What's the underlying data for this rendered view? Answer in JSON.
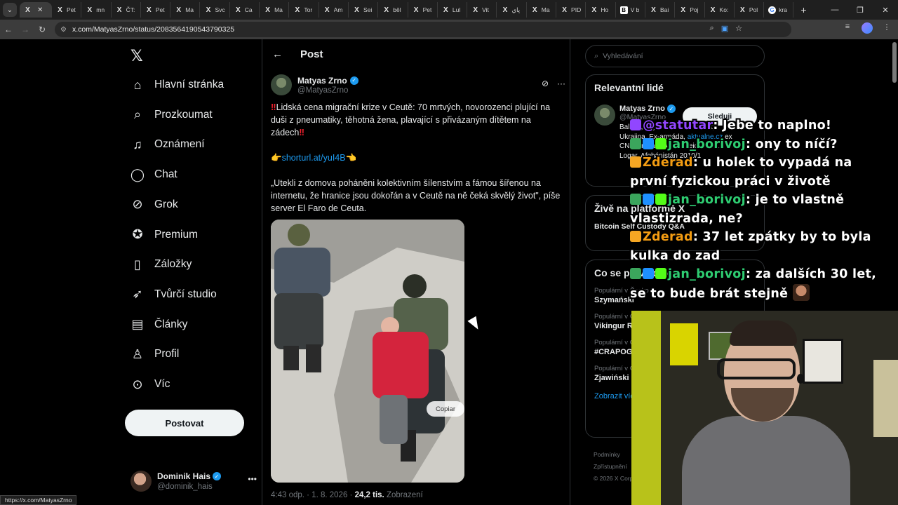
{
  "browser": {
    "tabs": [
      {
        "icon": "X",
        "title": "",
        "active": true
      },
      {
        "icon": "X",
        "title": "Pet"
      },
      {
        "icon": "X",
        "title": "mn"
      },
      {
        "icon": "X",
        "title": "ČT:"
      },
      {
        "icon": "X",
        "title": "Pet"
      },
      {
        "icon": "X",
        "title": "Ma"
      },
      {
        "icon": "X",
        "title": "Svc"
      },
      {
        "icon": "X",
        "title": "Ca"
      },
      {
        "icon": "X",
        "title": "Ma"
      },
      {
        "icon": "X",
        "title": "Tor"
      },
      {
        "icon": "X",
        "title": "Am"
      },
      {
        "icon": "X",
        "title": "Sei"
      },
      {
        "icon": "X",
        "title": "běl"
      },
      {
        "icon": "X",
        "title": "Pet"
      },
      {
        "icon": "X",
        "title": "Lul"
      },
      {
        "icon": "X",
        "title": "Vit"
      },
      {
        "icon": "X",
        "title": "پاي"
      },
      {
        "icon": "X",
        "title": "Ma"
      },
      {
        "icon": "X",
        "title": "PID"
      },
      {
        "icon": "X",
        "title": "Ho"
      },
      {
        "icon": "B",
        "title": "V b"
      },
      {
        "icon": "X",
        "title": "Bai"
      },
      {
        "icon": "X",
        "title": "Poj"
      },
      {
        "icon": "X",
        "title": "Ko:"
      },
      {
        "icon": "X",
        "title": "Pol"
      },
      {
        "icon": "G",
        "title": "kra"
      }
    ],
    "url": "x.com/MatyasZrno/status/2083564190543790325",
    "status_url": "https://x.com/MatyasZrno"
  },
  "nav": {
    "items": [
      {
        "label": "Hlavní stránka",
        "icon": "home-icon",
        "glyph": "⌂"
      },
      {
        "label": "Prozkoumat",
        "icon": "search-icon",
        "glyph": "⌕"
      },
      {
        "label": "Oznámení",
        "icon": "bell-icon",
        "glyph": "♫"
      },
      {
        "label": "Chat",
        "icon": "chat-icon",
        "glyph": "◯"
      },
      {
        "label": "Grok",
        "icon": "grok-icon",
        "glyph": "⊘"
      },
      {
        "label": "Premium",
        "icon": "premium-icon",
        "glyph": "✪"
      },
      {
        "label": "Záložky",
        "icon": "bookmark-icon",
        "glyph": "▯"
      },
      {
        "label": "Tvůrčí studio",
        "icon": "rocket-icon",
        "glyph": "➶"
      },
      {
        "label": "Články",
        "icon": "articles-icon",
        "glyph": "▤"
      },
      {
        "label": "Profil",
        "icon": "profile-icon",
        "glyph": "♙"
      },
      {
        "label": "Víc",
        "icon": "more-icon",
        "glyph": "⊙"
      }
    ],
    "post_button": "Postovat",
    "account": {
      "name": "Dominik Hais",
      "handle": "@dominik_hais"
    }
  },
  "main": {
    "title": "Post",
    "author": {
      "name": "Matyas Zrno",
      "handle": "@MatyasZrno"
    },
    "tweet": {
      "p1": "Lidská cena migrační krize v Ceutě: 70 mrtvých, novorozenci plující na duši z pneumatiky, těhotná žena, plavající s přivázaným dítětem na zádech",
      "link": "shorturl.at/yuI4B",
      "p3": "„Utekli z domova poháněni kolektivním šílenstvím a fámou šířenou na internetu, že hranice jsou dokořán a v Ceutě na ně čeká skvělý život\", píše server El Faro de Ceuta."
    },
    "media_button": "Copiar",
    "meta": {
      "time": "4:43 odp. · 1. 8. 2026 · ",
      "views": "24,2 tis.",
      "views_label": " Zobrazení"
    }
  },
  "right": {
    "search_placeholder": "Vyhledávání",
    "relevant": {
      "title": "Relevantní lidé",
      "name": "Matyas Zrno",
      "handle": "@MatyasZrno",
      "follow": "Sleduji",
      "bio1": "Balkán, Afghánistán, a teď taky Ukrajina. Ex-armáda, ",
      "bio_link": "aktualne.cz",
      "bio2": " ex CNN Prima News. Foreign desk. Hlídač. Logar, Afghánistán 2010/1"
    },
    "live": {
      "title": "Živě na platformě X",
      "item": "Bitcoin Self Custody Q&A"
    },
    "trends": {
      "title": "Co se právě děje",
      "items": [
        {
          "cat": "Populární v Česko",
          "name": "Szymański"
        },
        {
          "cat": "Populární v Česko",
          "name": "Vikingur Reykjavík"
        },
        {
          "cat": "Populární v Česko",
          "name": "#CRAPOG"
        },
        {
          "cat": "Populární v Česko",
          "name": "Zjawiński"
        }
      ],
      "show_more": "Zobrazit víc"
    },
    "footer": {
      "l1": "Podmínky",
      "l2": "Zpřístupnění",
      "l3": "© 2026 X Corp."
    }
  },
  "chat": [
    {
      "user": "@statutar",
      "color": "#9146ff",
      "msg": ": Jebe to naplno!",
      "badges": [
        "pp"
      ]
    },
    {
      "user": "jan_borivoj",
      "color": "#2ecc71",
      "msg": ": ony to níčí?",
      "badges": [
        "tw",
        "ms",
        "k"
      ]
    },
    {
      "user": "Zderad",
      "color": "#f39c12",
      "msg": ": u holek to vypadá na první fyzickou práci v životě",
      "badges": [
        "z"
      ]
    },
    {
      "user": "jan_borivoj",
      "color": "#2ecc71",
      "msg": ": je to vlastně vlastizrada, ne?",
      "badges": [
        "tw",
        "ms",
        "k"
      ]
    },
    {
      "user": "Zderad",
      "color": "#f39c12",
      "msg": ": 37 let zpátky by to byla kulka do zad",
      "badges": [
        "z"
      ]
    },
    {
      "user": "jan_borivoj",
      "color": "#2ecc71",
      "msg": ": za dalších 30 let, se to bude brát stejně",
      "badges": [
        "tw",
        "ms",
        "k"
      ]
    }
  ]
}
